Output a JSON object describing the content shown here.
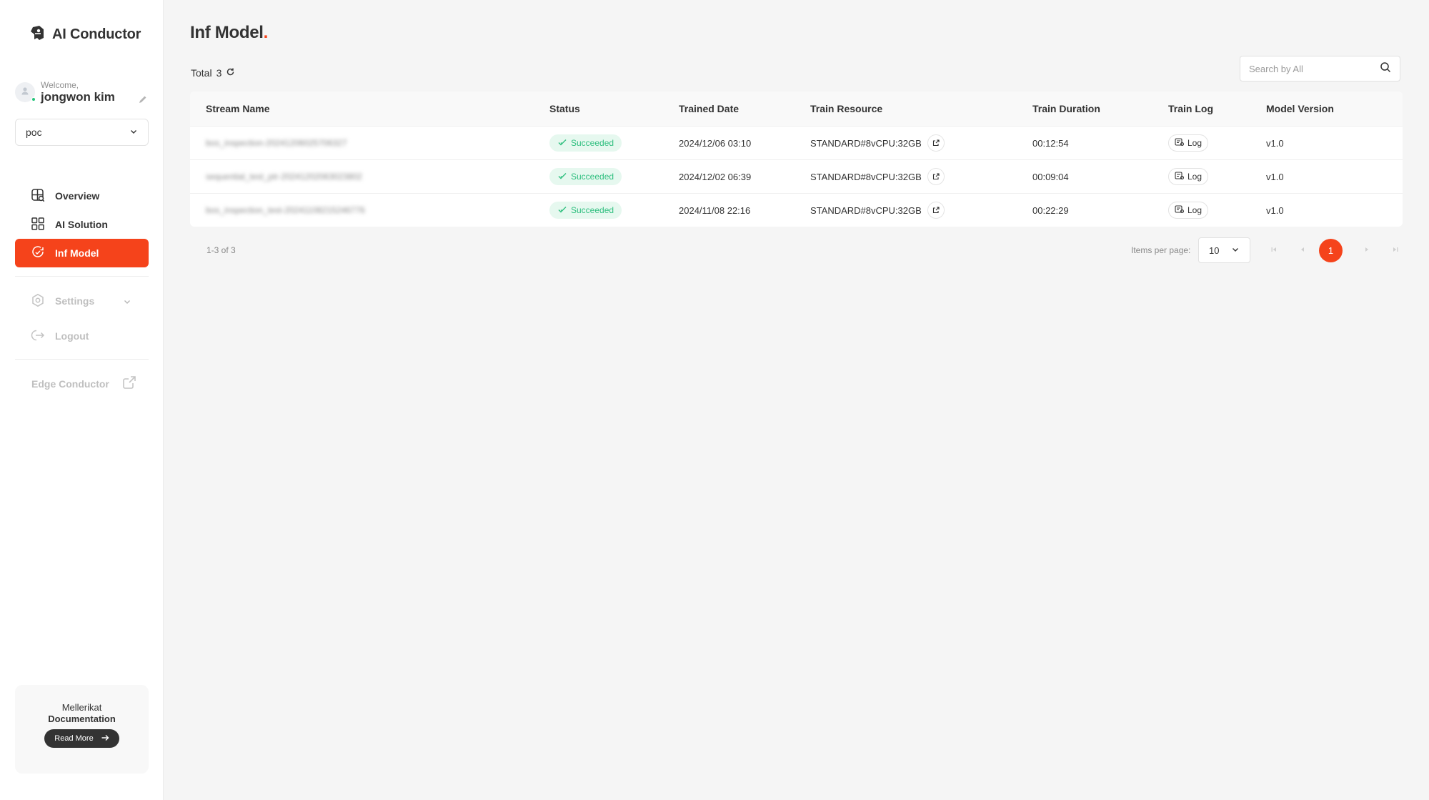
{
  "app": {
    "name": "AI Conductor"
  },
  "user": {
    "welcome": "Welcome,",
    "name": "jongwon kim"
  },
  "workspace": {
    "selected": "poc"
  },
  "nav": {
    "overview": "Overview",
    "ai_solution": "AI Solution",
    "inf_model": "Inf Model",
    "settings": "Settings",
    "logout": "Logout",
    "edge_conductor": "Edge Conductor"
  },
  "docs": {
    "line1": "Mellerikat",
    "line2": "Documentation",
    "button": "Read More"
  },
  "page": {
    "title": "Inf Model",
    "title_dot": ".",
    "total_label": "Total",
    "total_count": "3"
  },
  "search": {
    "placeholder": "Search by All"
  },
  "table": {
    "headers": [
      "Stream Name",
      "Status",
      "Trained Date",
      "Train Resource",
      "Train Duration",
      "Train Log",
      "Model Version"
    ],
    "rows": [
      {
        "stream": "bos_inspection-20241206025706327",
        "status": "Succeeded",
        "date": "2024/12/06 03:10",
        "resource": "STANDARD#8vCPU:32GB",
        "duration": "00:12:54",
        "log": "Log",
        "version": "v1.0"
      },
      {
        "stream": "sequential_test_ptr-20241202063023802",
        "status": "Succeeded",
        "date": "2024/12/02 06:39",
        "resource": "STANDARD#8vCPU:32GB",
        "duration": "00:09:04",
        "log": "Log",
        "version": "v1.0"
      },
      {
        "stream": "bos_inspection_test-20241108215246776",
        "status": "Succeeded",
        "date": "2024/11/08 22:16",
        "resource": "STANDARD#8vCPU:32GB",
        "duration": "00:22:29",
        "log": "Log",
        "version": "v1.0"
      }
    ]
  },
  "pagination": {
    "range": "1-3 of 3",
    "items_per_page_label": "Items per page:",
    "items_per_page": "10",
    "current_page": "1"
  },
  "colors": {
    "accent": "#f5431b",
    "success_bg": "#e6f8ef",
    "success_text": "#2fbf7f"
  },
  "icons": [
    "brand-logo-icon",
    "user-icon",
    "pencil-icon",
    "chevron-down-icon",
    "globe-search-icon",
    "grid-icon",
    "model-icon",
    "gear-icon",
    "logout-icon",
    "external-link-icon",
    "refresh-icon",
    "search-icon",
    "check-icon",
    "log-icon",
    "arrow-right-icon",
    "first-page-icon",
    "prev-page-icon",
    "next-page-icon",
    "last-page-icon"
  ]
}
